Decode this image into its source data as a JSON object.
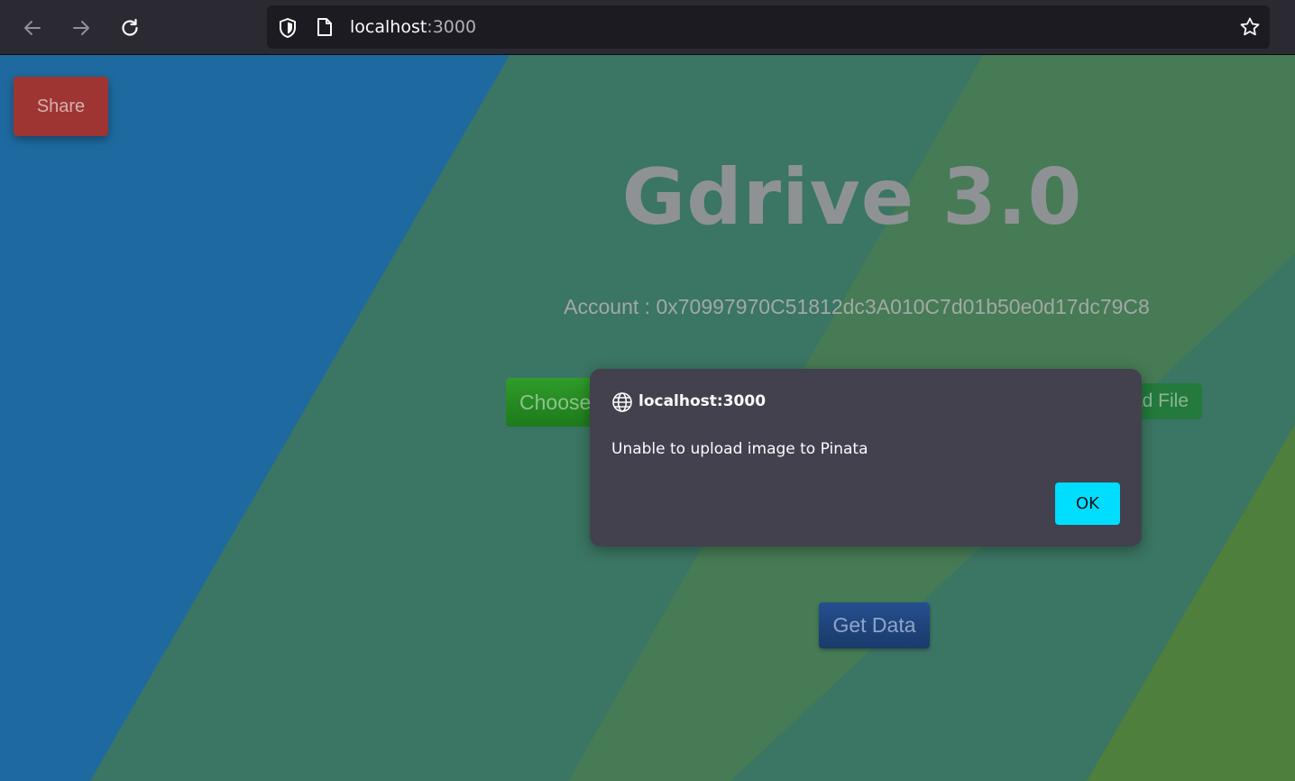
{
  "browser": {
    "url_host": "localhost",
    "url_port": ":3000",
    "icons": {
      "back": "arrow-left-icon",
      "forward": "arrow-right-icon",
      "reload": "reload-icon",
      "shield": "shield-icon",
      "page": "page-icon",
      "bookmark": "star-icon"
    }
  },
  "page": {
    "share_label": "Share",
    "title": "Gdrive 3.0",
    "account_text": "Account : 0x70997970C51812dc3A010C7d01b50e0d17dc79C8",
    "choose_label": "Choose",
    "upload_label": "ad File",
    "get_data_label": "Get Data",
    "colors": {
      "bg_blue": "#1e6aa0",
      "bg_teal": "#3b7563",
      "bg_green": "#467b55",
      "bg_lime": "#4f7f3c",
      "share": "#9e3533",
      "choose": "#2f9c2a",
      "upload": "#237a3c",
      "get_data": "#254f8e"
    }
  },
  "dialog": {
    "origin": "localhost:3000",
    "message": "Unable to upload image to Pinata",
    "ok_label": "OK",
    "icon": "globe-icon",
    "ok_color": "#00ddff"
  }
}
